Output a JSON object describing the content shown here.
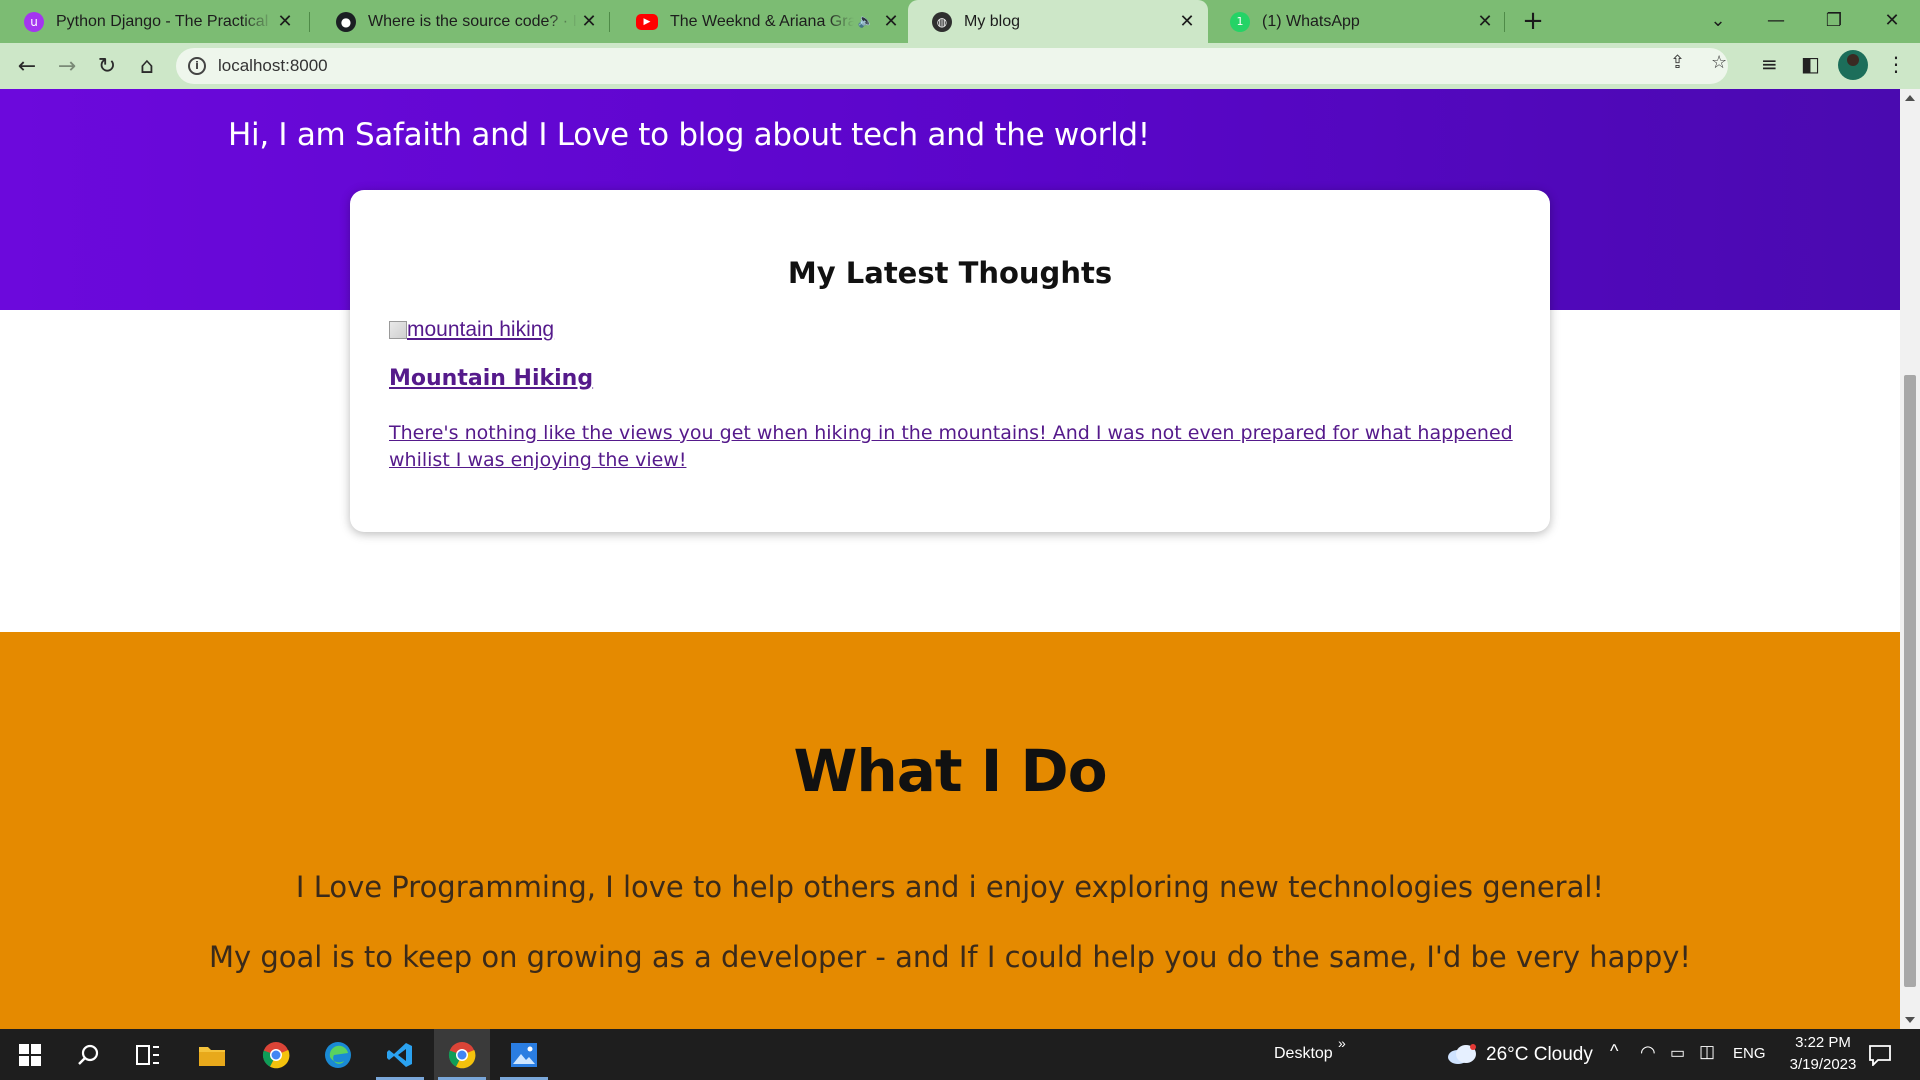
{
  "browser": {
    "tabs": [
      {
        "title": "Python Django - The Practical Guide",
        "icon": "udemy-icon",
        "active": false
      },
      {
        "title": "Where is the source code? · Issue",
        "icon": "github-icon",
        "active": false
      },
      {
        "title": "The Weeknd & Ariana Grande",
        "icon": "youtube-icon",
        "active": false,
        "audio": true
      },
      {
        "title": "My blog",
        "icon": "globe-icon",
        "active": true
      },
      {
        "title": "(1) WhatsApp",
        "icon": "whatsapp-icon",
        "active": false
      }
    ],
    "address": "localhost:8000"
  },
  "page": {
    "hero_tagline": "Hi, I am Safaith and I Love to blog about tech and the world!",
    "latest": {
      "heading": "My Latest Thoughts",
      "post": {
        "image_alt": "mountain hiking",
        "title": "Mountain Hiking",
        "excerpt": "There's nothing like the views you get when hiking in the mountains! And I was not even prepared for what happened whilist I was enjoying the view!"
      }
    },
    "what_i_do": {
      "heading": "What I Do",
      "lines": [
        "I Love Programming, I love to help others and i enjoy exploring new technologies general!",
        "My goal is to keep on growing as a developer - and If I could help you do the same, I'd be very happy!"
      ]
    }
  },
  "taskbar": {
    "desktop_label": "Desktop",
    "weather": "26°C  Cloudy",
    "language": "ENG",
    "time": "3:22 PM",
    "date": "3/19/2023"
  },
  "colors": {
    "hero_purple": "#6c09dc",
    "section_orange": "#e58a00",
    "visited_link": "#551a8b",
    "chrome_tabbar": "#7cbc73",
    "chrome_toolbar": "#cde7c8"
  }
}
